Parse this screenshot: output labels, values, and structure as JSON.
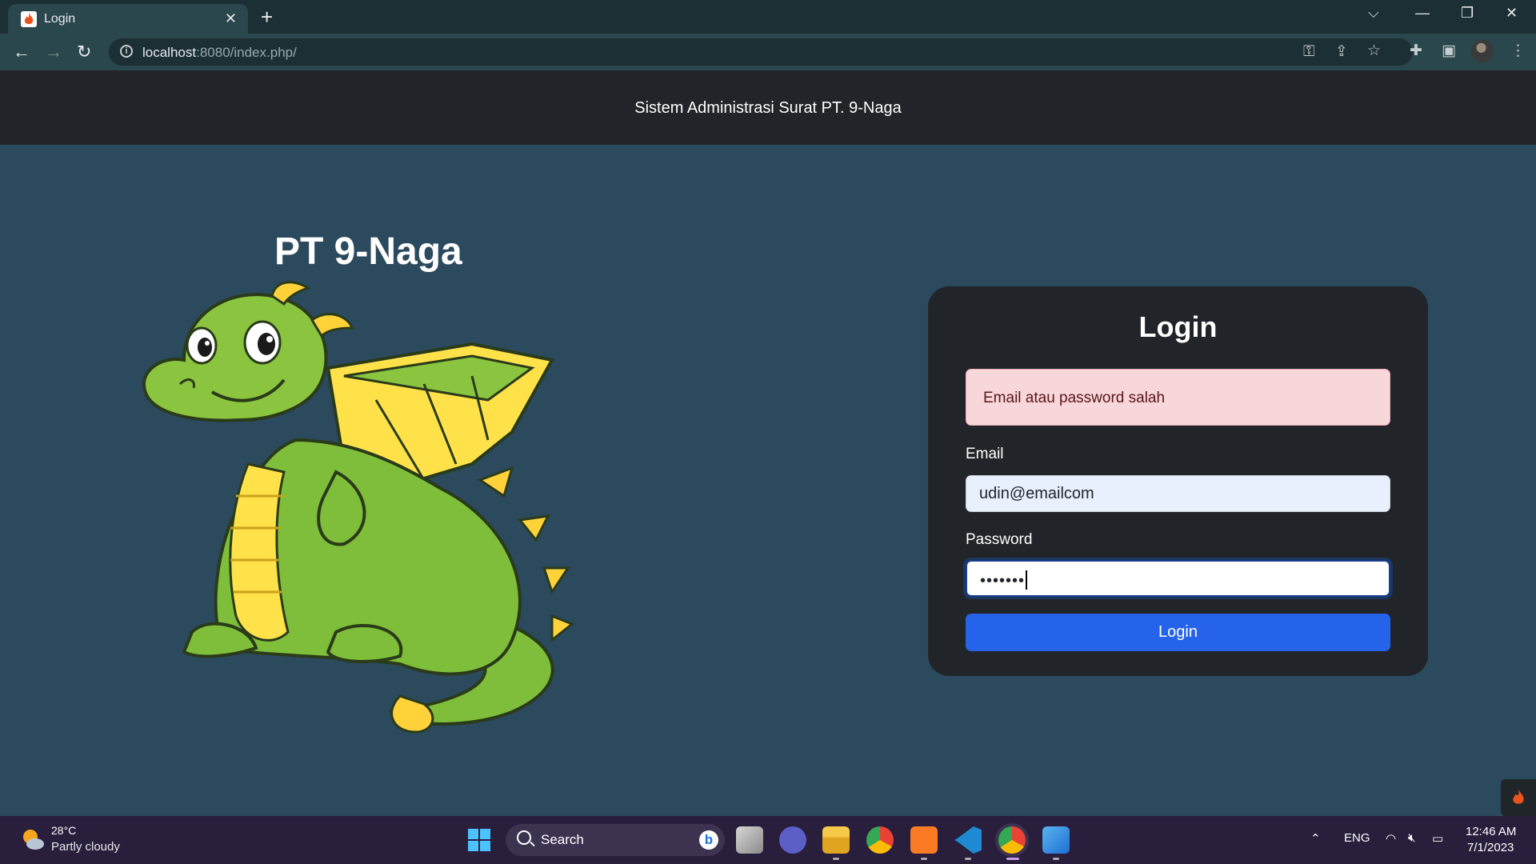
{
  "browser": {
    "tab_title": "Login",
    "url_host": "localhost",
    "url_rest": ":8080/index.php/"
  },
  "site": {
    "header_title": "Sistem Administrasi Surat PT. 9-Naga",
    "brand_title": "PT 9-Naga"
  },
  "login": {
    "heading": "Login",
    "alert_message": "Email atau password salah",
    "email_label": "Email",
    "email_value": "udin@emailcom",
    "password_label": "Password",
    "password_mask": "•••••••",
    "submit_label": "Login"
  },
  "taskbar": {
    "weather_temp": "28°C",
    "weather_desc": "Partly cloudy",
    "search_label": "Search",
    "language": "ENG",
    "time": "12:46 AM",
    "date": "7/1/2023"
  },
  "colors": {
    "page_bg": "#2c4a5e",
    "card_bg": "#212529",
    "alert_bg": "#f8d7da",
    "primary_button": "#2563eb"
  }
}
